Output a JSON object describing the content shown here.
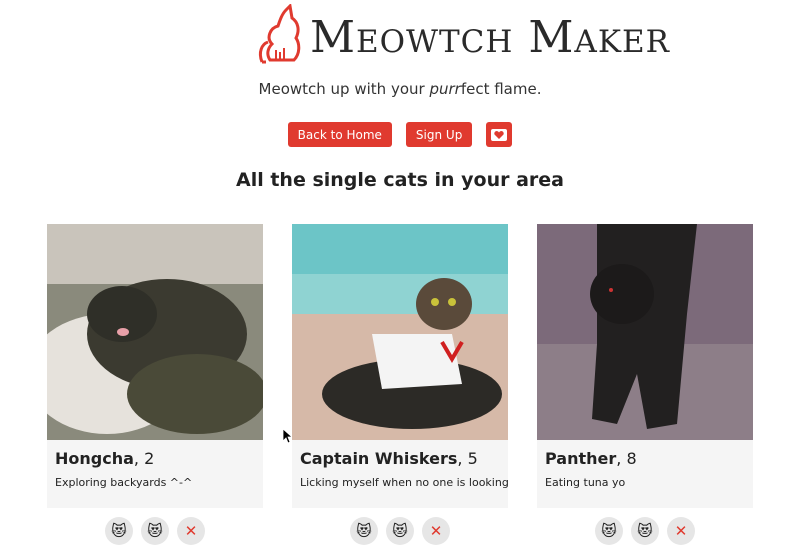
{
  "header": {
    "brand": "Meowtch Maker",
    "tagline_pre": "Meowtch up with your ",
    "tagline_em": "purr",
    "tagline_post": "fect flame."
  },
  "nav": {
    "back_label": "Back to Home",
    "signup_label": "Sign Up",
    "heart_icon": "heart-icon"
  },
  "section_title": "All the single cats in your area",
  "cats": [
    {
      "name": "Hongcha",
      "age": ", 2",
      "bio": "Exploring backyards ^-^"
    },
    {
      "name": "Captain Whiskers",
      "age": ", 5",
      "bio": "Licking myself when no one is looking"
    },
    {
      "name": "Panther",
      "age": ", 8",
      "bio": "Eating tuna yo"
    }
  ],
  "actions": {
    "like": "😻",
    "love": "😻",
    "pass": "✕"
  },
  "colors": {
    "accent": "#e03a2f",
    "card_bg": "#f5f5f5"
  }
}
